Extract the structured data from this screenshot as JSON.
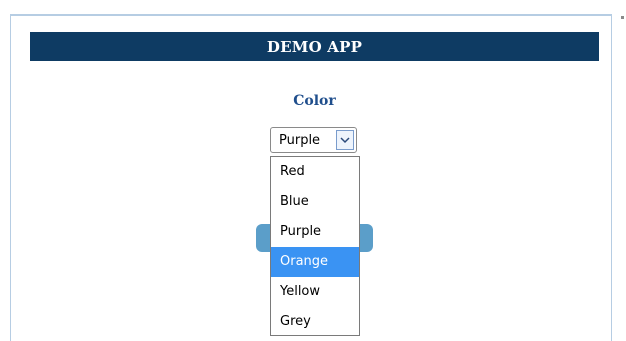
{
  "app": {
    "title": "DEMO APP",
    "header_color": "#0e3b63"
  },
  "form": {
    "color_label": "Color",
    "color_select": {
      "selected_value": "Purple",
      "arrow_icon": "chevron-down-icon",
      "options": [
        "Red",
        "Blue",
        "Purple",
        "Orange",
        "Yellow",
        "Grey"
      ],
      "highlighted_option": "Orange",
      "highlight_color": "#3a93f3"
    }
  }
}
